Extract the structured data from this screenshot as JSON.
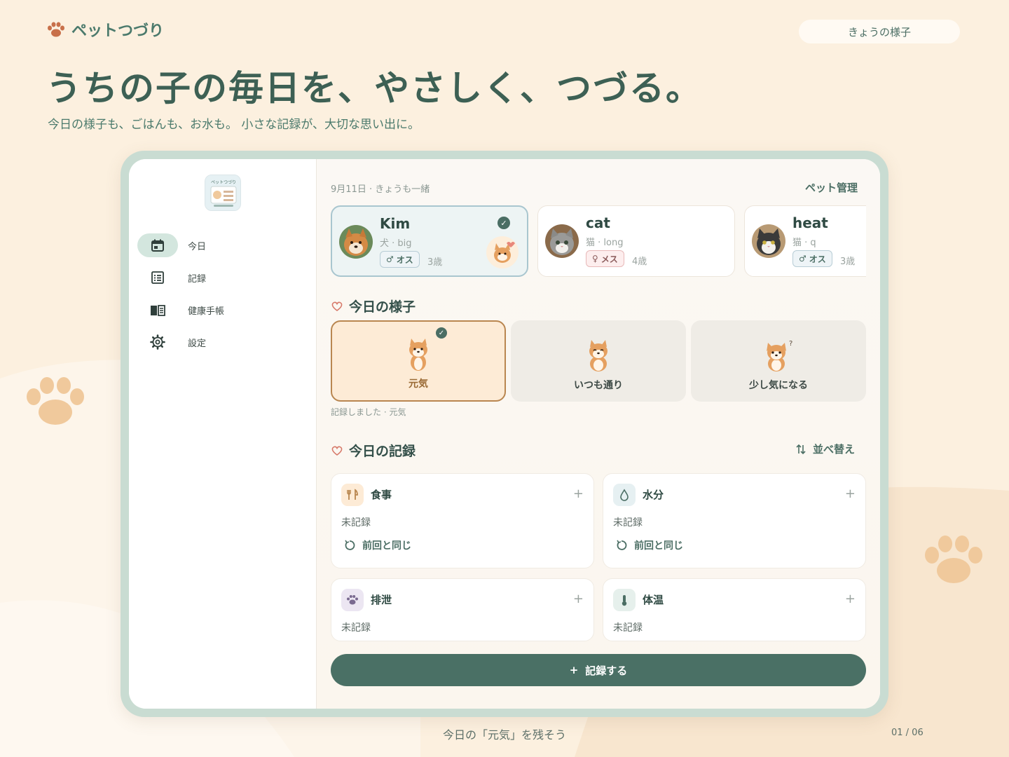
{
  "brand": {
    "name": "ペットつづり",
    "icon": "paw-icon"
  },
  "top_pill": "きょうの様子",
  "hero": {
    "title": "うちの子の毎日を、やさしく、つづる。",
    "subtitle": "今日の様子も、ごはんも、お水も。 小さな記録が、大切な思い出に。"
  },
  "footer": {
    "caption": "今日の「元気」を残そう",
    "page": "01 / 06"
  },
  "app": {
    "icon_label": "ペットつづり",
    "sidebar": {
      "items": [
        {
          "label": "今日",
          "icon": "calendar-icon",
          "active": true
        },
        {
          "label": "記録",
          "icon": "list-icon",
          "active": false
        },
        {
          "label": "健康手帳",
          "icon": "book-icon",
          "active": false
        },
        {
          "label": "設定",
          "icon": "gear-icon",
          "active": false
        }
      ]
    },
    "header": {
      "date": "9月11日 · きょうも一緒",
      "manage": "ペット管理"
    },
    "pets": [
      {
        "name": "Kim",
        "kind": "犬 · big",
        "sex": "オス",
        "sex_symbol": "♂",
        "age": "3歳",
        "selected": true
      },
      {
        "name": "cat",
        "kind": "猫 · long",
        "sex": "メス",
        "sex_symbol": "♀",
        "age": "4歳",
        "selected": false
      },
      {
        "name": "heat",
        "kind": "猫 · q",
        "sex": "オス",
        "sex_symbol": "♂",
        "age": "3歳",
        "selected": false
      }
    ],
    "mood": {
      "title": "今日の様子",
      "options": [
        {
          "label": "元気",
          "selected": true
        },
        {
          "label": "いつも通り",
          "selected": false
        },
        {
          "label": "少し気になる",
          "selected": false
        }
      ],
      "note": "記録しました · 元気"
    },
    "records": {
      "title": "今日の記録",
      "sort": "並べ替え",
      "items": [
        {
          "title": "食事",
          "icon": "fork-knife-icon",
          "status": "未記録",
          "repeat": "前回と同じ",
          "icon_bg": "#fdebd6",
          "icon_color": "#b8864f"
        },
        {
          "title": "水分",
          "icon": "water-drop-icon",
          "status": "未記録",
          "repeat": "前回と同じ",
          "icon_bg": "#e6f0f2",
          "icon_color": "#4b6e64"
        },
        {
          "title": "排泄",
          "icon": "paw-icon",
          "status": "未記録",
          "icon_bg": "#ece6f2",
          "icon_color": "#7a6a90"
        },
        {
          "title": "体温",
          "icon": "thermometer-icon",
          "status": "未記録",
          "icon_bg": "#e6f0ec",
          "icon_color": "#4b6e64"
        }
      ],
      "plus": "+"
    },
    "record_button": "記録する",
    "record_button_plus": "+"
  },
  "colors": {
    "accent": "#4a7065",
    "background": "#fcf0df",
    "paw": "#f0c99c"
  }
}
